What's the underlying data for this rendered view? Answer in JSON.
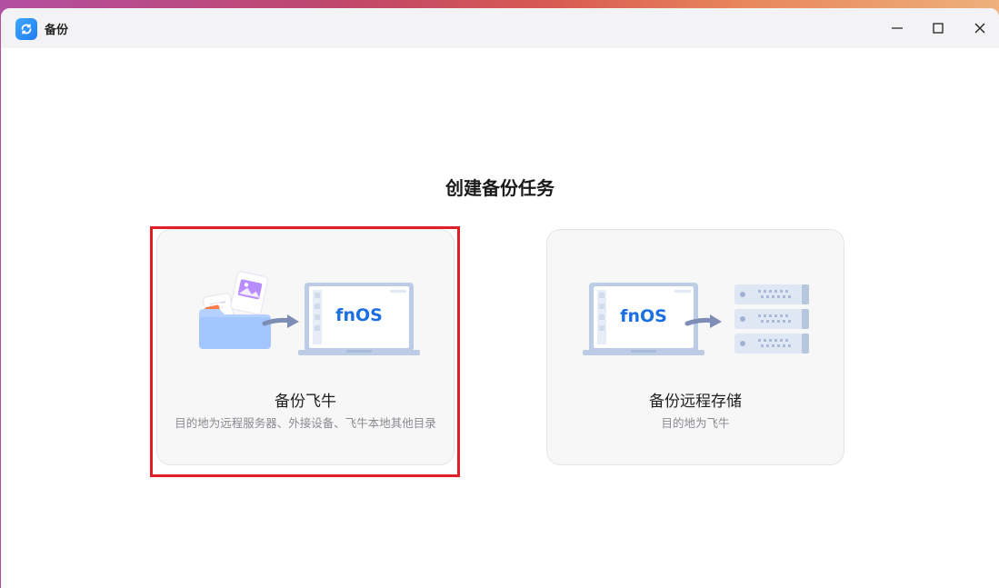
{
  "window": {
    "title": "备份"
  },
  "main": {
    "heading": "创建备份任务",
    "cards": [
      {
        "title": "备份飞牛",
        "description": "目的地为远程服务器、外接设备、飞牛本地其他目录",
        "device_label": "fnOS"
      },
      {
        "title": "备份远程存储",
        "description": "目的地为飞牛",
        "device_label": "fnOS"
      }
    ]
  },
  "colors": {
    "accent_blue": "#1c6fe3",
    "highlight_red": "#e01e26",
    "card_bg": "#f7f7f8"
  },
  "icons": {
    "app": "backup-sync-icon",
    "minimize": "minimize-icon",
    "maximize": "maximize-icon",
    "close": "close-icon"
  }
}
